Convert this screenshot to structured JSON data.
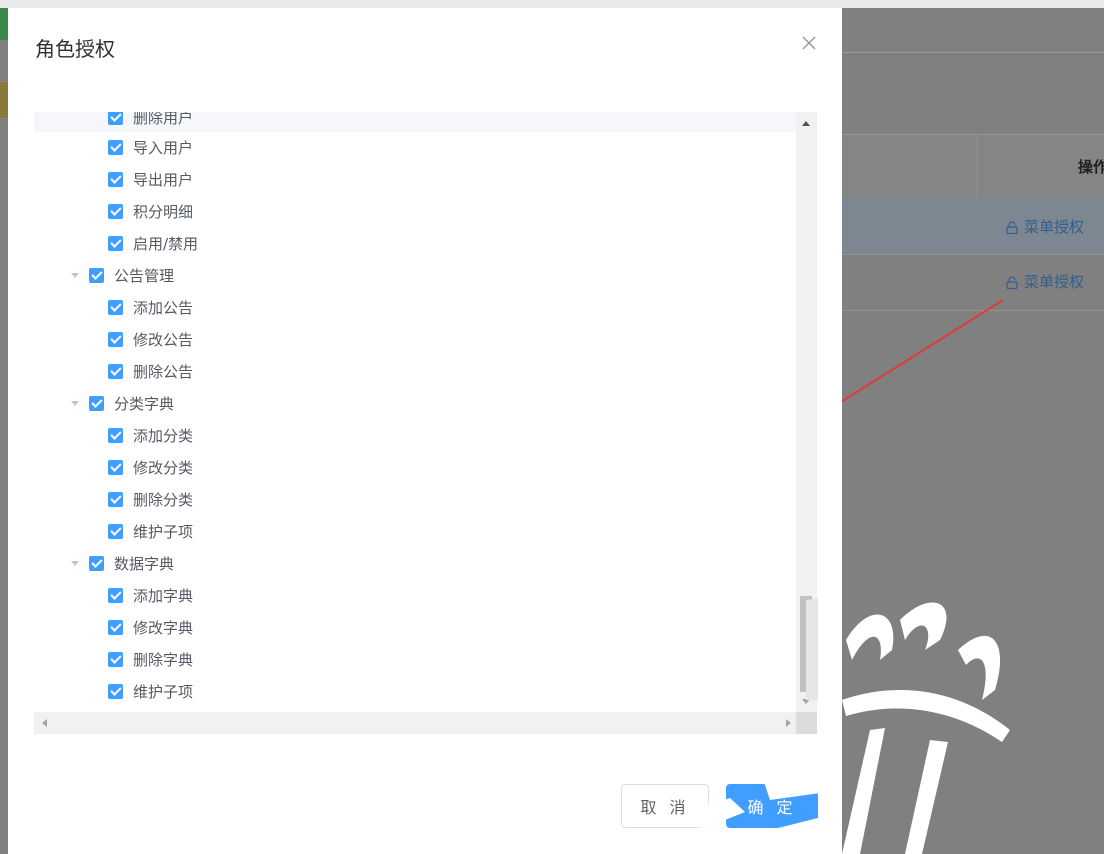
{
  "background": {
    "table_header": "操作",
    "rows": [
      {
        "action_label": "菜单授权"
      },
      {
        "action_label": "菜单授权"
      }
    ],
    "colors": {
      "link": "#335e8e",
      "overlay": "#808080"
    }
  },
  "dialog": {
    "title": "角色授权",
    "close_icon": "close-icon",
    "tree": [
      {
        "label": "删除用户",
        "level": 2,
        "checked": true
      },
      {
        "label": "导入用户",
        "level": 2,
        "checked": true
      },
      {
        "label": "导出用户",
        "level": 2,
        "checked": true
      },
      {
        "label": "积分明细",
        "level": 2,
        "checked": true
      },
      {
        "label": "启用/禁用",
        "level": 2,
        "checked": true
      },
      {
        "label": "公告管理",
        "level": 1,
        "checked": true,
        "expanded": true
      },
      {
        "label": "添加公告",
        "level": 2,
        "checked": true
      },
      {
        "label": "修改公告",
        "level": 2,
        "checked": true
      },
      {
        "label": "删除公告",
        "level": 2,
        "checked": true
      },
      {
        "label": "分类字典",
        "level": 1,
        "checked": true,
        "expanded": true
      },
      {
        "label": "添加分类",
        "level": 2,
        "checked": true
      },
      {
        "label": "修改分类",
        "level": 2,
        "checked": true
      },
      {
        "label": "删除分类",
        "level": 2,
        "checked": true
      },
      {
        "label": "维护子项",
        "level": 2,
        "checked": true
      },
      {
        "label": "数据字典",
        "level": 1,
        "checked": true,
        "expanded": true
      },
      {
        "label": "添加字典",
        "level": 2,
        "checked": true
      },
      {
        "label": "修改字典",
        "level": 2,
        "checked": true
      },
      {
        "label": "删除字典",
        "level": 2,
        "checked": true
      },
      {
        "label": "维护子项",
        "level": 2,
        "checked": true
      }
    ],
    "buttons": {
      "cancel": "取 消",
      "ok": "确 定"
    },
    "colors": {
      "primary": "#409eff",
      "checkbox": "#409eff",
      "text": "#555a62"
    }
  }
}
